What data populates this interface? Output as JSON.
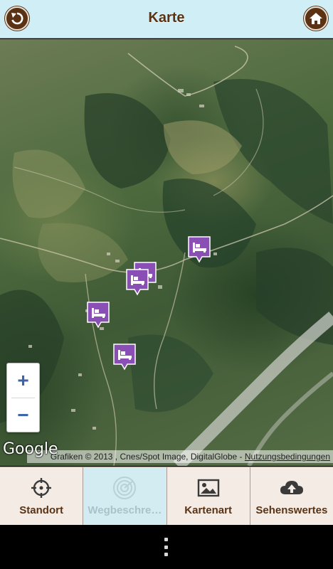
{
  "header": {
    "title": "Karte",
    "back_icon": "back-arrow-icon",
    "home_icon": "home-icon",
    "brand_color": "#5b3314",
    "background_color": "#cfeef5"
  },
  "map": {
    "type": "satellite",
    "markers": [
      {
        "name": "hotel-marker-1",
        "icon": "bed-icon",
        "color": "#8a4fb5"
      },
      {
        "name": "hotel-marker-2",
        "icon": "bed-icon",
        "color": "#8a4fb5"
      },
      {
        "name": "hotel-marker-3",
        "icon": "bed-icon",
        "color": "#8a4fb5"
      },
      {
        "name": "hotel-marker-4",
        "icon": "bed-icon",
        "color": "#8a4fb5"
      },
      {
        "name": "hotel-marker-5",
        "icon": "bed-icon",
        "color": "#8a4fb5"
      },
      {
        "name": "hotel-marker-6",
        "icon": "bed-icon",
        "color": "#8a4fb5"
      }
    ],
    "zoom_in_label": "+",
    "zoom_out_label": "−",
    "logo_text": "Google",
    "attribution_text": "Grafiken © 2013 , Cnes/Spot Image, DigitalGlobe - ",
    "terms_link": "Nutzungsbedingungen"
  },
  "tabs": [
    {
      "label": "Standort",
      "icon": "crosshair-icon",
      "enabled": true
    },
    {
      "label": "Wegbeschre…",
      "icon": "radar-icon",
      "enabled": false
    },
    {
      "label": "Kartenart",
      "icon": "picture-icon",
      "enabled": true
    },
    {
      "label": "Sehenswertes",
      "icon": "cloud-upload-icon",
      "enabled": true
    }
  ],
  "system_nav": {
    "menu_icon": "overflow-menu-icon"
  }
}
